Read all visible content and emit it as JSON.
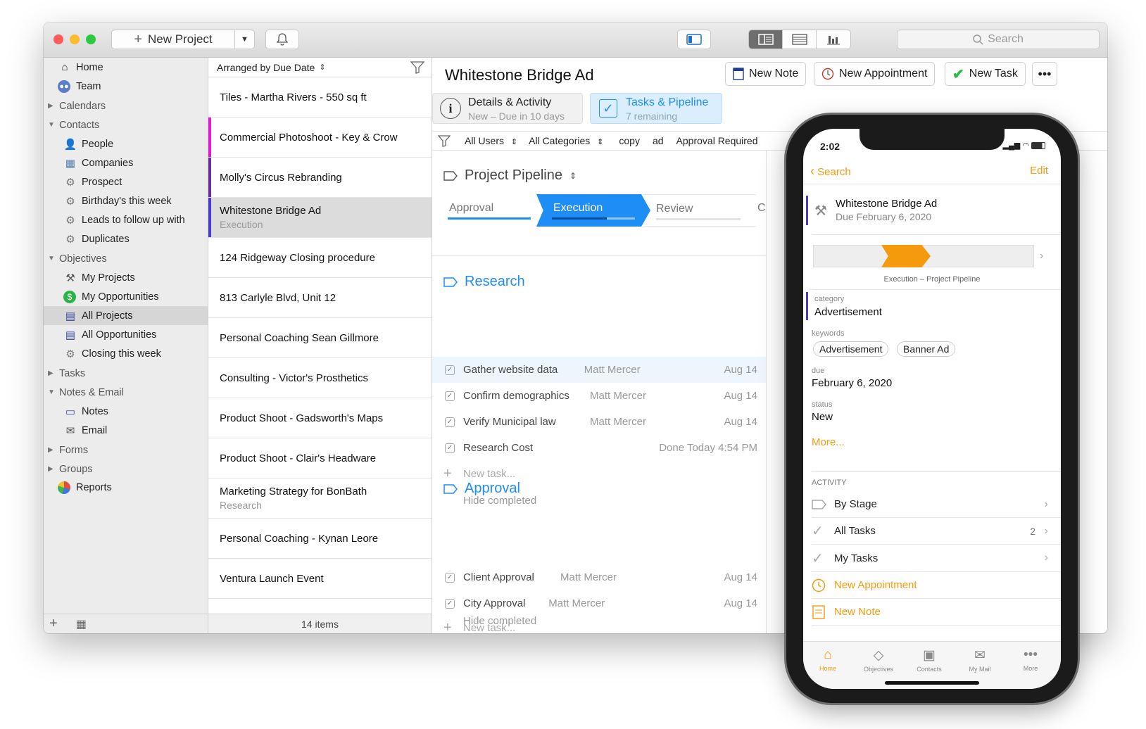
{
  "toolbar": {
    "new_project": "New Project",
    "search_placeholder": "Search"
  },
  "sidebar": {
    "home": "Home",
    "team": "Team",
    "calendars": "Calendars",
    "contacts": "Contacts",
    "people": "People",
    "companies": "Companies",
    "prospect": "Prospect",
    "birthdays": "Birthday's this week",
    "leads": "Leads to follow up with",
    "duplicates": "Duplicates",
    "objectives": "Objectives",
    "my_projects": "My Projects",
    "my_opportunities": "My Opportunities",
    "all_projects": "All Projects",
    "all_opportunities": "All Opportunities",
    "closing": "Closing this week",
    "tasks": "Tasks",
    "notes_email": "Notes & Email",
    "notes": "Notes",
    "email": "Email",
    "forms": "Forms",
    "groups": "Groups",
    "reports": "Reports"
  },
  "list": {
    "arranged": "Arranged by Due Date",
    "rows": [
      {
        "title": "Tiles - Martha Rivers - 550 sq ft",
        "sub": "",
        "bar": ""
      },
      {
        "title": "Commercial Photoshoot - Key & Crow",
        "sub": "",
        "bar": "#e21bd1"
      },
      {
        "title": "Molly's Circus Rebranding",
        "sub": "",
        "bar": "#6a2d9a"
      },
      {
        "title": "Whitestone Bridge Ad",
        "sub": "Execution",
        "bar": "#4a3ad0"
      },
      {
        "title": "124 Ridgeway Closing procedure",
        "sub": "",
        "bar": ""
      },
      {
        "title": "813 Carlyle Blvd, Unit 12",
        "sub": "",
        "bar": ""
      },
      {
        "title": "Personal Coaching Sean Gillmore",
        "sub": "",
        "bar": ""
      },
      {
        "title": "Consulting - Victor's Prosthetics",
        "sub": "",
        "bar": ""
      },
      {
        "title": "Product Shoot - Gadsworth's Maps",
        "sub": "",
        "bar": ""
      },
      {
        "title": "Product Shoot - Clair's Headware",
        "sub": "",
        "bar": ""
      },
      {
        "title": "Marketing Strategy for BonBath",
        "sub": "Research",
        "bar": ""
      },
      {
        "title": "Personal Coaching - Kynan Leore",
        "sub": "",
        "bar": ""
      },
      {
        "title": "Ventura Launch Event",
        "sub": "",
        "bar": ""
      }
    ],
    "footer": "14 items"
  },
  "detail": {
    "title": "Whitestone Bridge Ad",
    "new_note": "New Note",
    "new_appointment": "New Appointment",
    "new_task": "New Task",
    "tab_details": "Details & Activity",
    "tab_details_sub": "New – Due in 10 days",
    "tab_tasks": "Tasks & Pipeline",
    "tab_tasks_sub": "7 remaining",
    "filter_users": "All Users",
    "filter_categories": "All Categories",
    "filter_copy": "copy",
    "filter_ad": "ad",
    "filter_approval": "Approval Required",
    "pipeline_title": "Project Pipeline",
    "stages": [
      "Approval",
      "Execution",
      "Review",
      "C"
    ],
    "research": "Research",
    "approval": "Approval",
    "research_tasks": [
      {
        "name": "Gather website data",
        "who": "Matt Mercer",
        "date": "Aug 14"
      },
      {
        "name": "Confirm demographics",
        "who": "Matt Mercer",
        "date": "Aug 14"
      },
      {
        "name": "Verify Municipal law",
        "who": "Matt Mercer",
        "date": "Aug 14"
      },
      {
        "name": "Research Cost",
        "who": "",
        "date": "Done Today 4:54 PM"
      }
    ],
    "approval_tasks": [
      {
        "name": "Client Approval",
        "who": "Matt Mercer",
        "date": "Aug 14"
      },
      {
        "name": "City Approval",
        "who": "Matt Mercer",
        "date": "Aug 14"
      }
    ],
    "new_task_placeholder": "New task...",
    "hide_completed": "Hide completed"
  },
  "phone": {
    "time": "2:02",
    "back": "Search",
    "edit": "Edit",
    "title": "Whitestone Bridge Ad",
    "due_line": "Due February 6, 2020",
    "pipeline_caption": "Execution – Project Pipeline",
    "category_label": "category",
    "category": "Advertisement",
    "keywords_label": "keywords",
    "kw1": "Advertisement",
    "kw2": "Banner Ad",
    "due_label": "due",
    "due": "February 6, 2020",
    "status_label": "status",
    "status": "New",
    "more": "More...",
    "activity": "ACTIVITY",
    "by_stage": "By Stage",
    "all_tasks": "All Tasks",
    "all_tasks_count": "2",
    "my_tasks": "My Tasks",
    "new_appointment": "New Appointment",
    "new_note": "New Note",
    "tabs": [
      "Home",
      "Objectives",
      "Contacts",
      "My Mail",
      "More"
    ]
  },
  "colors": {
    "accent": "#1e8df5",
    "orange": "#f59a0c",
    "selected": "#d6d6d6"
  }
}
